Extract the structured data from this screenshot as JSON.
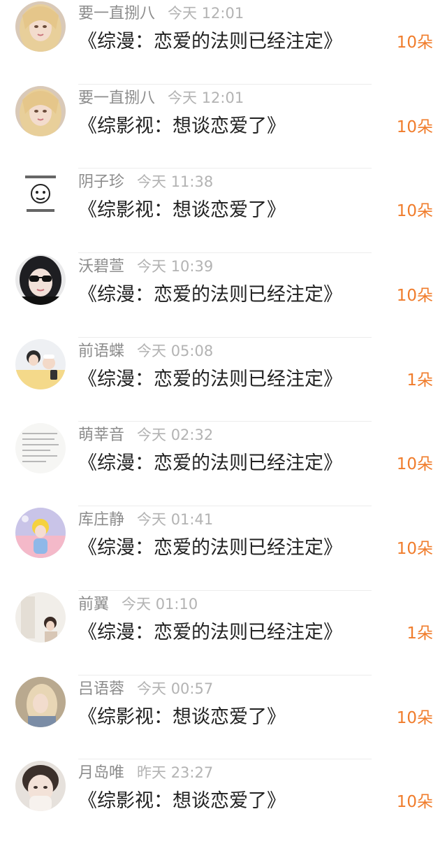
{
  "colors": {
    "username": "#8c8c8c",
    "time": "#b3b3b3",
    "title": "#222222",
    "gift_count": "#f07c2b",
    "divider": "#ececec"
  },
  "gift_list": [
    {
      "username": "要一直捌八",
      "time": "今天 12:01",
      "title": "《综漫：恋爱的法则已经注定》",
      "gift": "10朵",
      "avatar_icon": "anime-girl-avatar"
    },
    {
      "username": "要一直捌八",
      "time": "今天 12:01",
      "title": "《综影视：想谈恋爱了》",
      "gift": "10朵",
      "avatar_icon": "anime-girl-avatar"
    },
    {
      "username": "阴子珍",
      "time": "今天 11:38",
      "title": "《综影视：想谈恋爱了》",
      "gift": "10朵",
      "avatar_icon": "meme-sticker-avatar"
    },
    {
      "username": "沃碧萱",
      "time": "今天 10:39",
      "title": "《综漫：恋爱的法则已经注定》",
      "gift": "10朵",
      "avatar_icon": "sunglasses-girl-avatar"
    },
    {
      "username": "前语蝶",
      "time": "今天 05:08",
      "title": "《综漫：恋爱的法则已经注定》",
      "gift": "1朵",
      "avatar_icon": "couple-photo-avatar"
    },
    {
      "username": "萌莘音",
      "time": "今天 02:32",
      "title": "《综漫：恋爱的法则已经注定》",
      "gift": "10朵",
      "avatar_icon": "text-page-avatar"
    },
    {
      "username": "库庄静",
      "time": "今天 01:41",
      "title": "《综漫：恋爱的法则已经注定》",
      "gift": "10朵",
      "avatar_icon": "illustration-avatar"
    },
    {
      "username": "前翼",
      "time": "今天 01:10",
      "title": "《综漫：恋爱的法则已经注定》",
      "gift": "1朵",
      "avatar_icon": "room-photo-avatar"
    },
    {
      "username": "吕语蓉",
      "time": "今天 00:57",
      "title": "《综影视：想谈恋爱了》",
      "gift": "10朵",
      "avatar_icon": "blonde-girl-avatar"
    },
    {
      "username": "月岛唯",
      "time": "昨天 23:27",
      "title": "《综影视：想谈恋爱了》",
      "gift": "10朵",
      "avatar_icon": "face-closeup-avatar"
    }
  ]
}
